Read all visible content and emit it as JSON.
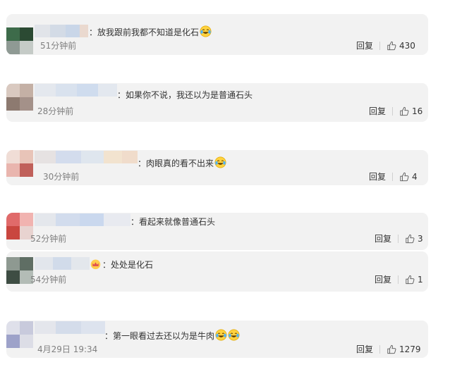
{
  "comments": [
    {
      "sep": "：",
      "text": "放我跟前我都不知道是化石",
      "emoji_count": 1,
      "emoji_icon": "laugh-cry-icon",
      "time": "51分钟前",
      "reply": "回复",
      "likes": "430"
    },
    {
      "sep": "：",
      "text": "如果你不说，我还以为是普通石头",
      "emoji_count": 0,
      "time": "28分钟前",
      "reply": "回复",
      "likes": "16"
    },
    {
      "sep": "：",
      "text": "肉眼真的看不出来",
      "emoji_count": 1,
      "emoji_icon": "laugh-cry-icon",
      "time": "30分钟前",
      "reply": "回复",
      "likes": "4"
    },
    {
      "sep": "：",
      "text": "看起来就像普通石头",
      "emoji_count": 0,
      "time": "52分钟前",
      "reply": "回复",
      "likes": "3"
    },
    {
      "sep": "：",
      "text": "处处是化石",
      "emoji_count": 0,
      "badge_icon": "crown-badge-icon",
      "time": "54分钟前",
      "reply": "回复",
      "likes": "1"
    },
    {
      "sep": "：",
      "text": "第一眼看过去还以为是牛肉",
      "emoji_count": 2,
      "emoji_icon": "laugh-cry-icon",
      "time": "4月29日 19:34",
      "reply": "回复",
      "likes": "1279"
    }
  ],
  "icons": {
    "like": "thumbs-up-icon",
    "emoji": "laugh-cry-icon"
  },
  "colors": {
    "card_bg": "#f2f2f2",
    "text": "#333333",
    "meta": "#808080"
  }
}
